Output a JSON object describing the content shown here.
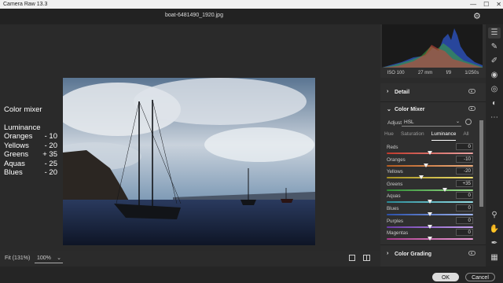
{
  "window": {
    "title": "Camera Raw 13.3",
    "controls": [
      "—",
      "☐",
      "✕"
    ]
  },
  "header": {
    "filename": "boat-6481490_1920.jpg"
  },
  "overlay": {
    "title": "Color mixer",
    "subtitle": "Luminance",
    "rows": [
      {
        "name": "Oranges",
        "value": "- 10"
      },
      {
        "name": "Yellows",
        "value": "- 20"
      },
      {
        "name": "Greens",
        "value": "+ 35"
      },
      {
        "name": "Aquas",
        "value": "- 25"
      },
      {
        "name": "Blues",
        "value": "- 20"
      }
    ]
  },
  "bottombar": {
    "fit_label": "Fit (131%)",
    "zoom": "100%"
  },
  "exif": {
    "iso": "ISO 100",
    "focal": "27 mm",
    "aperture": "f/9",
    "shutter": "1/250s"
  },
  "panel": {
    "sections": {
      "detail": "Detail",
      "color_mixer": "Color Mixer",
      "color_grading": "Color Grading"
    },
    "adjust_label": "Adjust",
    "adjust_value": "HSL",
    "tabs": [
      "Hue",
      "Saturation",
      "Luminance",
      "All"
    ],
    "active_tab": "Luminance",
    "sliders": [
      {
        "label": "Reds",
        "value": "0",
        "amount": 0,
        "colors": [
          "#c0392b",
          "#e9a0a0"
        ]
      },
      {
        "label": "Oranges",
        "value": "-10",
        "amount": -10,
        "colors": [
          "#b35a1f",
          "#f0b080"
        ]
      },
      {
        "label": "Yellows",
        "value": "-20",
        "amount": -20,
        "colors": [
          "#a59020",
          "#f0e070"
        ]
      },
      {
        "label": "Greens",
        "value": "+35",
        "amount": 35,
        "colors": [
          "#2f8a34",
          "#9fe08f"
        ]
      },
      {
        "label": "Aquas",
        "value": "0",
        "amount": 0,
        "colors": [
          "#2a8a96",
          "#95e0e8"
        ]
      },
      {
        "label": "Blues",
        "value": "0",
        "amount": 0,
        "colors": [
          "#2a4fa8",
          "#9fb5ef"
        ]
      },
      {
        "label": "Purples",
        "value": "0",
        "amount": 0,
        "colors": [
          "#6a3aa8",
          "#c4a0ef"
        ]
      },
      {
        "label": "Magentas",
        "value": "0",
        "amount": 0,
        "colors": [
          "#a83a8a",
          "#efa0d8"
        ]
      }
    ]
  },
  "footer": {
    "ok_label": "OK",
    "cancel_label": "Cancel"
  },
  "colors": {
    "panel_bg": "#2f2f2f",
    "canvas_bg": "#2a2a2a",
    "accent": "#dcdcdc"
  }
}
